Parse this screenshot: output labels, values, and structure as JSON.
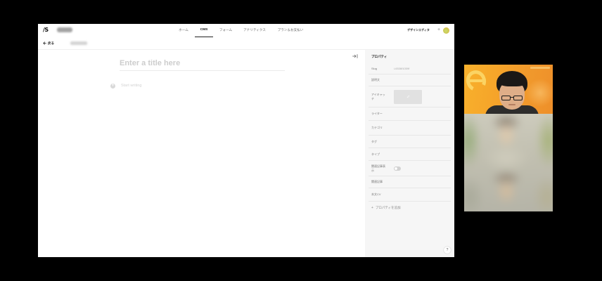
{
  "app": {
    "logo": "/S",
    "nav": [
      {
        "label": "ホーム",
        "active": false
      },
      {
        "label": "CMS",
        "active": true
      },
      {
        "label": "フォーム",
        "active": false
      },
      {
        "label": "アナリティクス",
        "active": false
      },
      {
        "label": "プラン＆お支払い",
        "active": false
      }
    ],
    "design_editor_label": "デザインエディタ",
    "add_label": "+",
    "avatar_icon": "user-avatar-icon"
  },
  "subbar": {
    "back_icon": "arrow-left-icon",
    "back_label": "戻る"
  },
  "editor": {
    "title_placeholder": "Enter a title here",
    "add_block_label": "+",
    "body_placeholder": "Start writing",
    "collapse_icon": "panel-collapse-icon"
  },
  "panel": {
    "title": "プロパティ",
    "properties": [
      {
        "label": "Slug",
        "value": "i-6536f1059f"
      },
      {
        "label": "説明文"
      },
      {
        "label": "アイキャッチ",
        "icon": "pencil-icon"
      },
      {
        "label": "ライター"
      },
      {
        "label": "カテゴリ"
      },
      {
        "label": "タグ"
      },
      {
        "label": "タイプ"
      },
      {
        "label": "関連記事表示",
        "toggle_on": false
      },
      {
        "label": "関連記事"
      },
      {
        "label": "本文CV"
      }
    ],
    "add_property_plus": "+",
    "add_property_label": "プロパティを追加"
  },
  "help_label": "?",
  "colors": {
    "page_background": "#000000",
    "panel_background": "#f6f6f6",
    "accent": "#222222",
    "video_background": "#f5a02a"
  }
}
